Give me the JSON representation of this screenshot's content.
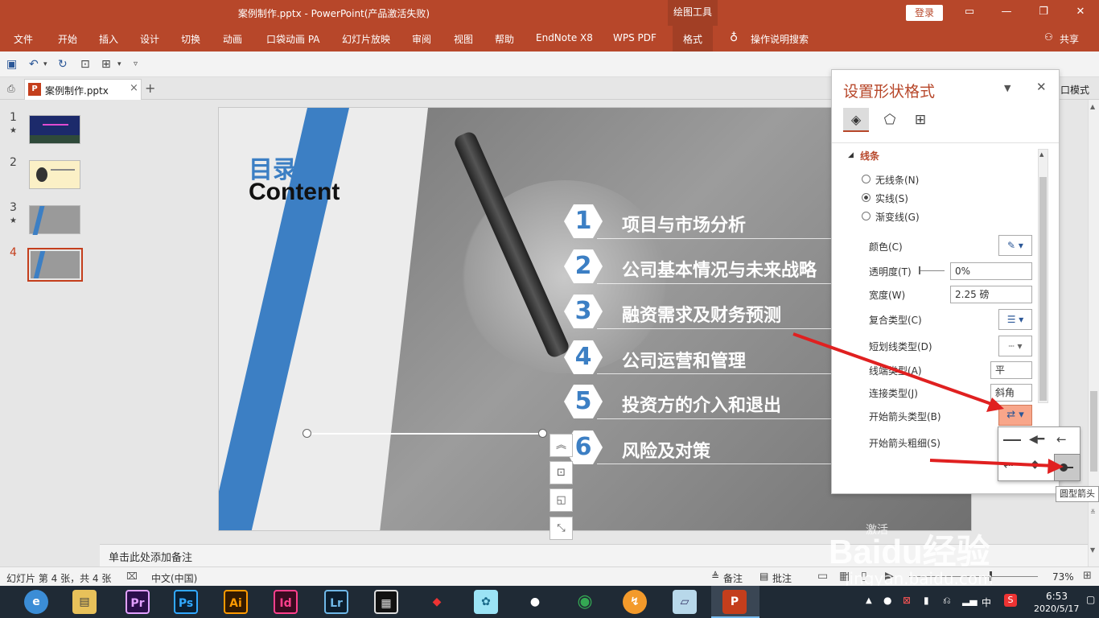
{
  "window": {
    "title": "案例制作.pptx  -  PowerPoint(产品激活失败)",
    "context_tab": "绘图工具",
    "login_label": "登录",
    "share_label": "共享"
  },
  "ribbon": {
    "tabs": [
      "文件",
      "开始",
      "插入",
      "设计",
      "切换",
      "动画",
      "口袋动画 PA",
      "幻灯片放映",
      "审阅",
      "视图",
      "帮助",
      "EndNote X8",
      "WPS PDF",
      "格式"
    ],
    "search_label": "操作说明搜索"
  },
  "doc_tab": {
    "label": "案例制作.pptx",
    "close": "×",
    "add": "+"
  },
  "thumbnails": [
    {
      "num": "1",
      "star": "★",
      "active": false
    },
    {
      "num": "2",
      "star": "",
      "active": false
    },
    {
      "num": "3",
      "star": "★",
      "active": false
    },
    {
      "num": "4",
      "star": "",
      "active": true
    }
  ],
  "slide": {
    "heading_cn": "目录",
    "heading_en": "Content",
    "items": [
      {
        "num": "1",
        "text": "项目与市场分析"
      },
      {
        "num": "2",
        "text": "公司基本情况与未来战略"
      },
      {
        "num": "3",
        "text": "融资需求及财务预测"
      },
      {
        "num": "4",
        "text": "公司运营和管理"
      },
      {
        "num": "5",
        "text": "投资方的介入和退出"
      },
      {
        "num": "6",
        "text": "风险及对策"
      }
    ]
  },
  "notes_placeholder": "单击此处添加备注",
  "status": {
    "slide_info": "幻灯片 第 4 张，共 4 张",
    "language": "中文(中国)",
    "notes_btn": "备注",
    "comments_btn": "批注",
    "zoom": "73%",
    "mode_fragment": "口模式"
  },
  "pane": {
    "title": "设置形状格式",
    "section": "线条",
    "radio_none": "无线条(N)",
    "radio_solid": "实线(S)",
    "radio_gradient": "渐变线(G)",
    "color_label": "颜色(C)",
    "transparency_label": "透明度(T)",
    "transparency_value": "0%",
    "width_label": "宽度(W)",
    "width_value": "2.25 磅",
    "compound_label": "复合类型(C)",
    "dash_label": "短划线类型(D)",
    "cap_label": "线端类型(A)",
    "cap_value": "平",
    "join_label": "连接类型(J)",
    "join_value": "斜角",
    "begin_arrow_label": "开始箭头类型(B)",
    "begin_size_label": "开始箭头粗细(S)",
    "tooltip": "圆型箭头"
  },
  "taskbar": {
    "apps": [
      "Pr",
      "Ps",
      "Ai",
      "Id",
      "Lr"
    ],
    "time": "6:53",
    "date": "2020/5/17",
    "ime": "中"
  },
  "watermark": {
    "text": "Baidu经验",
    "url": "jingyan.baidu.com",
    "activate": "激活"
  },
  "colors": {
    "accent": "#b7472a",
    "slide_blue": "#3c7fc4",
    "arrow_red": "#e02020"
  }
}
